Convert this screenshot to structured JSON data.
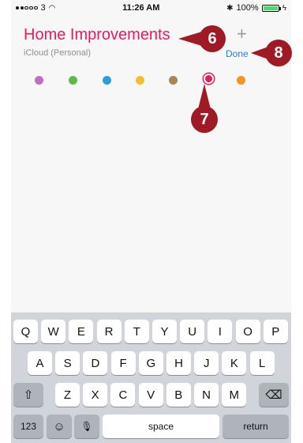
{
  "status_bar": {
    "carrier": "3",
    "time": "11:26 AM",
    "battery": "100%"
  },
  "header": {
    "title": "Home Improvements",
    "account": "iCloud (Personal)",
    "add_label": "+",
    "done_label": "Done"
  },
  "swatches": {
    "colors": [
      "#bf6fbf",
      "#60b84a",
      "#2c9fdb",
      "#f0c12b",
      "#a78556",
      "#e8195e",
      "#f7931e"
    ],
    "selected": "#e8195e"
  },
  "keyboard": {
    "row1": [
      "Q",
      "W",
      "E",
      "R",
      "T",
      "Y",
      "U",
      "I",
      "O",
      "P"
    ],
    "row2": [
      "A",
      "S",
      "D",
      "F",
      "G",
      "H",
      "J",
      "K",
      "L"
    ],
    "row3": [
      "Z",
      "X",
      "C",
      "V",
      "B",
      "N",
      "M"
    ],
    "numbers_label": "123",
    "space_label": "space",
    "return_label": "return"
  },
  "callouts": {
    "title_step": "6",
    "color_step": "7",
    "done_step": "8"
  }
}
